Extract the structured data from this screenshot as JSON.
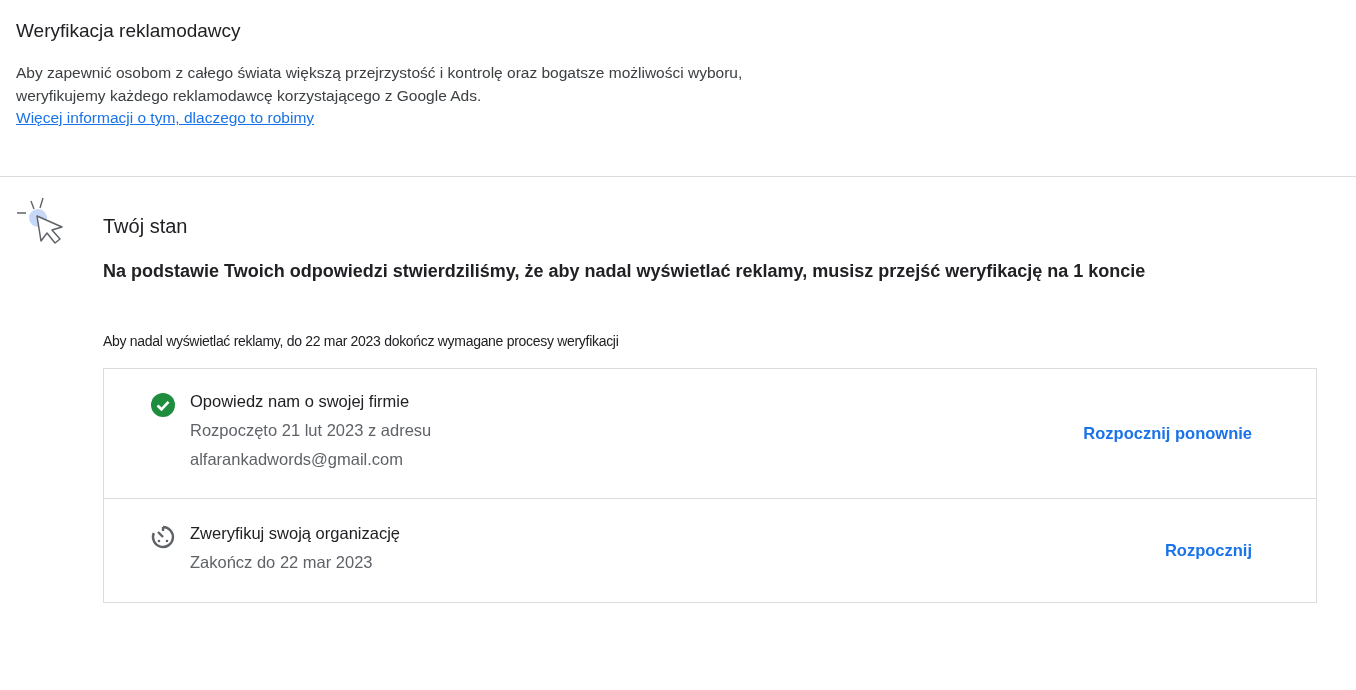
{
  "header": {
    "title": "Weryfikacja reklamodawcy",
    "description": "Aby zapewnić osobom z całego świata większą przejrzystość i kontrolę oraz bogatsze możliwości wyboru, weryfikujemy każdego reklamodawcę korzystającego z Google Ads.",
    "link": "Więcej informacji o tym, dlaczego to robimy"
  },
  "status": {
    "title": "Twój stan",
    "message": "Na podstawie Twoich odpowiedzi stwierdziliśmy, że aby nadal wyświetlać reklamy, musisz przejść weryfikację na 1 koncie",
    "deadline_note": "Aby nadal wyświetlać reklamy, do 22 mar 2023 dokończ wymagane procesy weryfikacji"
  },
  "steps": [
    {
      "kind": "done",
      "title": "Opowiedz nam o swojej firmie",
      "details": [
        "Rozpoczęto 21 lut 2023 z adresu",
        "alfarankadwords@gmail.com"
      ],
      "action": "Rozpocznij ponownie"
    },
    {
      "kind": "pending",
      "title": "Zweryfikuj swoją organizację",
      "details": [
        "Zakończ do 22 mar 2023"
      ],
      "action": "Rozpocznij"
    }
  ]
}
